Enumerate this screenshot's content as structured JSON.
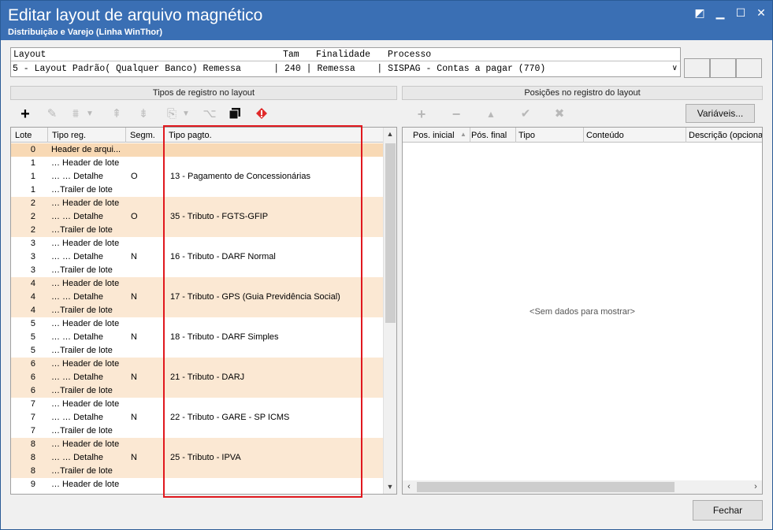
{
  "window": {
    "title": "Editar layout de arquivo magnético",
    "subtitle": "Distribuição e Varejo (Linha WinThor)"
  },
  "layout_selector": {
    "headers": [
      "Layout",
      "Tam",
      "Finalidade",
      "Processo"
    ],
    "value": "5 - Layout Padrão( Qualquer Banco) Remessa      | 240 | Remessa    | SISPAG - Contas a pagar (770)"
  },
  "left_panel": {
    "title": "Tipos de registro no layout",
    "columns": [
      "Lote",
      "Tipo reg.",
      "Segm.",
      "Tipo pagto."
    ],
    "rows": [
      {
        "lote": "0",
        "tipo": "Header de arqui...",
        "seg": "",
        "pag": ""
      },
      {
        "lote": "1",
        "tipo": "… Header de lote",
        "seg": "",
        "pag": ""
      },
      {
        "lote": "1",
        "tipo": "… … Detalhe",
        "seg": "O",
        "pag": "13 - Pagamento de Concessionárias"
      },
      {
        "lote": "1",
        "tipo": "…Trailer de lote",
        "seg": "",
        "pag": ""
      },
      {
        "lote": "2",
        "tipo": "… Header de lote",
        "seg": "",
        "pag": ""
      },
      {
        "lote": "2",
        "tipo": "… … Detalhe",
        "seg": "O",
        "pag": "35 - Tributo - FGTS-GFIP"
      },
      {
        "lote": "2",
        "tipo": "…Trailer de lote",
        "seg": "",
        "pag": ""
      },
      {
        "lote": "3",
        "tipo": "… Header de lote",
        "seg": "",
        "pag": ""
      },
      {
        "lote": "3",
        "tipo": "… … Detalhe",
        "seg": "N",
        "pag": "16 - Tributo - DARF Normal"
      },
      {
        "lote": "3",
        "tipo": "…Trailer de lote",
        "seg": "",
        "pag": ""
      },
      {
        "lote": "4",
        "tipo": "… Header de lote",
        "seg": "",
        "pag": ""
      },
      {
        "lote": "4",
        "tipo": "… … Detalhe",
        "seg": "N",
        "pag": "17 - Tributo - GPS (Guia Previdência Social)"
      },
      {
        "lote": "4",
        "tipo": "…Trailer de lote",
        "seg": "",
        "pag": ""
      },
      {
        "lote": "5",
        "tipo": "… Header de lote",
        "seg": "",
        "pag": ""
      },
      {
        "lote": "5",
        "tipo": "… … Detalhe",
        "seg": "N",
        "pag": "18 - Tributo - DARF Simples"
      },
      {
        "lote": "5",
        "tipo": "…Trailer de lote",
        "seg": "",
        "pag": ""
      },
      {
        "lote": "6",
        "tipo": "… Header de lote",
        "seg": "",
        "pag": ""
      },
      {
        "lote": "6",
        "tipo": "… … Detalhe",
        "seg": "N",
        "pag": "21 - Tributo - DARJ"
      },
      {
        "lote": "6",
        "tipo": "…Trailer de lote",
        "seg": "",
        "pag": ""
      },
      {
        "lote": "7",
        "tipo": "… Header de lote",
        "seg": "",
        "pag": ""
      },
      {
        "lote": "7",
        "tipo": "… … Detalhe",
        "seg": "N",
        "pag": "22 - Tributo - GARE - SP ICMS"
      },
      {
        "lote": "7",
        "tipo": "…Trailer de lote",
        "seg": "",
        "pag": ""
      },
      {
        "lote": "8",
        "tipo": "… Header de lote",
        "seg": "",
        "pag": ""
      },
      {
        "lote": "8",
        "tipo": "… … Detalhe",
        "seg": "N",
        "pag": "25 - Tributo - IPVA"
      },
      {
        "lote": "8",
        "tipo": "…Trailer de lote",
        "seg": "",
        "pag": ""
      },
      {
        "lote": "9",
        "tipo": "… Header de lote",
        "seg": "",
        "pag": ""
      }
    ]
  },
  "right_panel": {
    "title": "Posições no registro do layout",
    "variables_button": "Variáveis...",
    "columns": [
      "Pos. inicial",
      "Pós. final",
      "Tipo",
      "Conteúdo",
      "Descrição (opcional)"
    ],
    "empty_message": "<Sem dados para mostrar>"
  },
  "footer": {
    "close_button": "Fechar"
  },
  "colors": {
    "titlebar": "#3a6fb4",
    "row_band": "#fbe8d3",
    "highlight_border": "#e0181e"
  }
}
